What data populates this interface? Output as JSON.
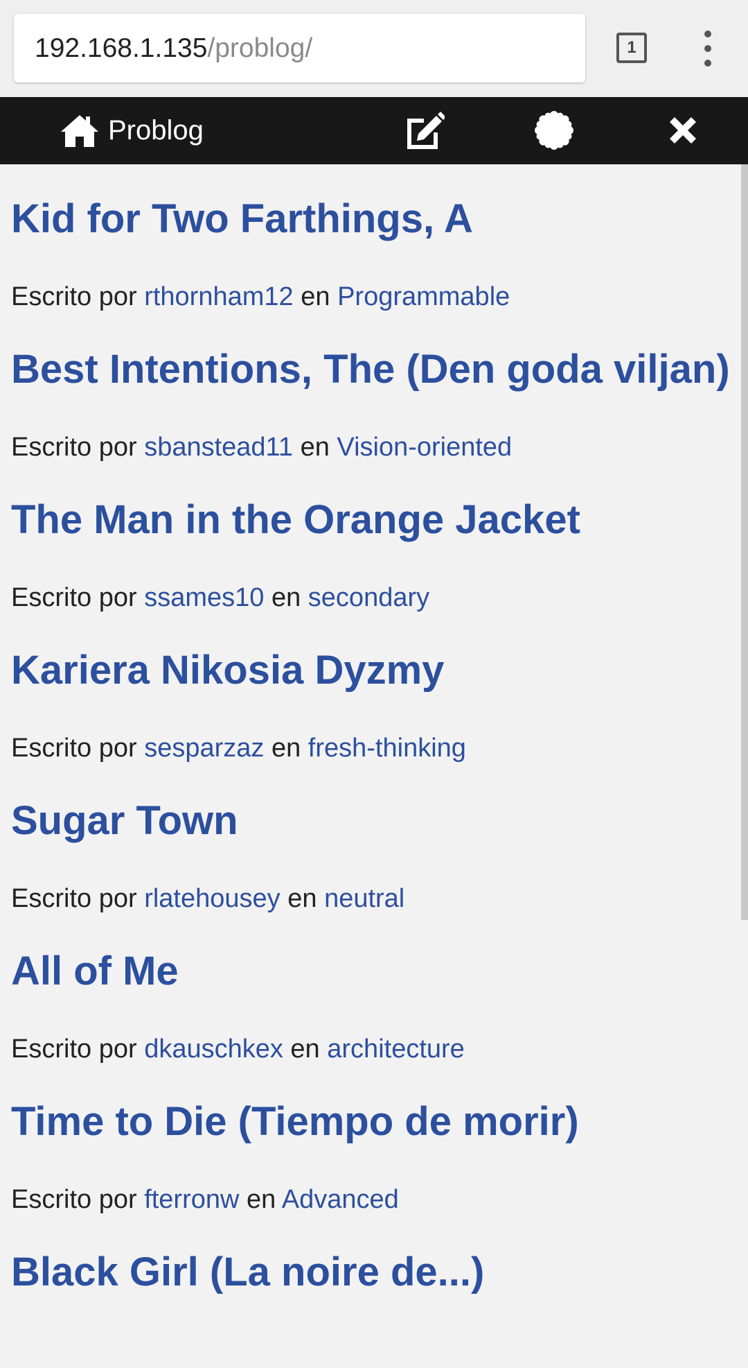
{
  "browser": {
    "url_host": "192.168.1.135",
    "url_path": "/problog/",
    "tab_count": "1"
  },
  "navbar": {
    "brand_label": "Problog",
    "icons": [
      "home-icon",
      "edit-icon",
      "gear-icon",
      "close-icon"
    ]
  },
  "meta_prefix": "Escrito por",
  "meta_joiner": "en",
  "colors": {
    "link": "#2c4f9e",
    "navbar_bg": "#181818",
    "page_bg": "#f2f2f2"
  },
  "posts": [
    {
      "title": "Kid for Two Farthings, A",
      "author": "rthornham12",
      "category": "Programmable"
    },
    {
      "title": "Best Intentions, The (Den goda viljan)",
      "author": "sbanstead11",
      "category": "Vision-oriented"
    },
    {
      "title": "The Man in the Orange Jacket",
      "author": "ssames10",
      "category": "secondary"
    },
    {
      "title": "Kariera Nikosia Dyzmy",
      "author": "sesparzaz",
      "category": "fresh-thinking"
    },
    {
      "title": "Sugar Town",
      "author": "rlatehousey",
      "category": "neutral"
    },
    {
      "title": "All of Me",
      "author": "dkauschkex",
      "category": "architecture"
    },
    {
      "title": "Time to Die (Tiempo de morir)",
      "author": "fterronw",
      "category": "Advanced"
    },
    {
      "title": "Black Girl (La noire de...)",
      "author": "",
      "category": ""
    }
  ]
}
